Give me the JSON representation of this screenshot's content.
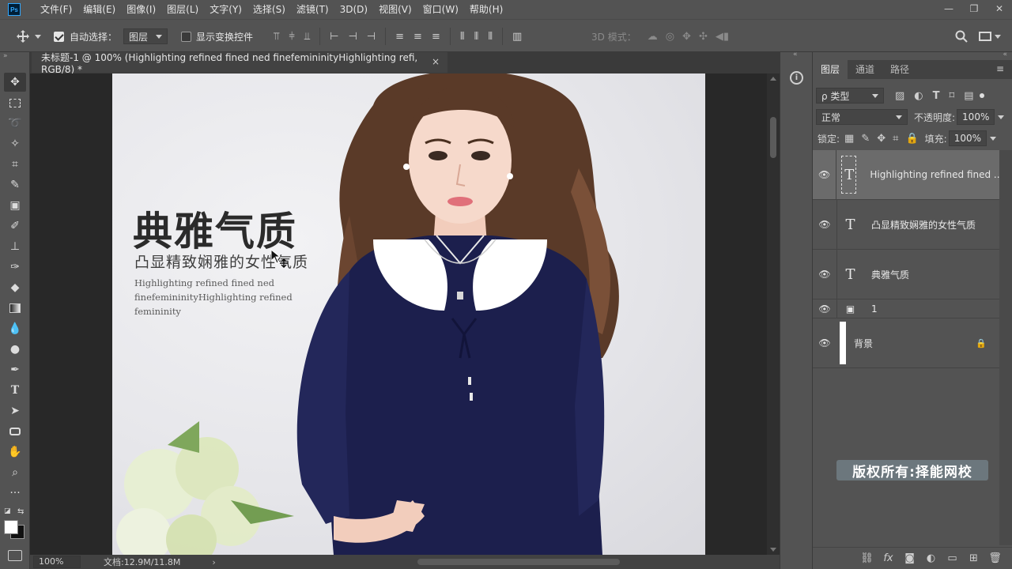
{
  "app": {
    "logo": "Ps"
  },
  "menu": [
    "文件(F)",
    "编辑(E)",
    "图像(I)",
    "图层(L)",
    "文字(Y)",
    "选择(S)",
    "滤镜(T)",
    "3D(D)",
    "视图(V)",
    "窗口(W)",
    "帮助(H)"
  ],
  "window_controls": {
    "minimize": "—",
    "restore": "❐",
    "close": "✕"
  },
  "options": {
    "auto_select_label": "自动选择：",
    "auto_select_checked": true,
    "auto_select_target": "图层",
    "show_transform_label": "显示变换控件",
    "show_transform_checked": false,
    "mode_3d_label": "3D 模式："
  },
  "document": {
    "tab_title": "未标题-1 @ 100% (Highlighting refined fined  ned finefemininityHighlighting refi, RGB/8) *",
    "close": "×"
  },
  "canvas_text": {
    "headline": "典雅气质",
    "subhead": "凸显精致娴雅的女性气质",
    "body_line1": "Highlighting refined fined  ned",
    "body_line2": "finefemininityHighlighting refined",
    "body_line3": "femininity"
  },
  "status": {
    "zoom": "100%",
    "doc_size": "文档:12.9M/11.8M",
    "arrow": "›"
  },
  "panel": {
    "tabs": [
      "图层",
      "通道",
      "路径"
    ],
    "active_tab": 0,
    "filter_kind": "ρ 类型",
    "blend_mode": "正常",
    "opacity_label": "不透明度:",
    "opacity_value": "100%",
    "lock_label": "锁定:",
    "fill_label": "填充:",
    "fill_value": "100%"
  },
  "layers": [
    {
      "name": "Highlighting refined fined ...",
      "type": "text",
      "thumb": "T",
      "selected": true
    },
    {
      "name": "凸显精致娴雅的女性气质",
      "type": "text",
      "thumb": "T",
      "selected": false
    },
    {
      "name": "典雅气质",
      "type": "text",
      "thumb": "T",
      "selected": false
    },
    {
      "name": "1",
      "type": "smart",
      "thumb": "▣",
      "selected": false
    },
    {
      "name": "背景",
      "type": "background",
      "thumb": "",
      "selected": false,
      "locked": true
    }
  ],
  "watermark": "版权所有:择能网校",
  "icons": {
    "move": "move-icon",
    "search": "search-icon",
    "workspace": "workspace-icon",
    "info": "info-icon",
    "eye": "eye-icon",
    "lock": "lock-icon",
    "panel_menu": "panel-menu-icon"
  }
}
